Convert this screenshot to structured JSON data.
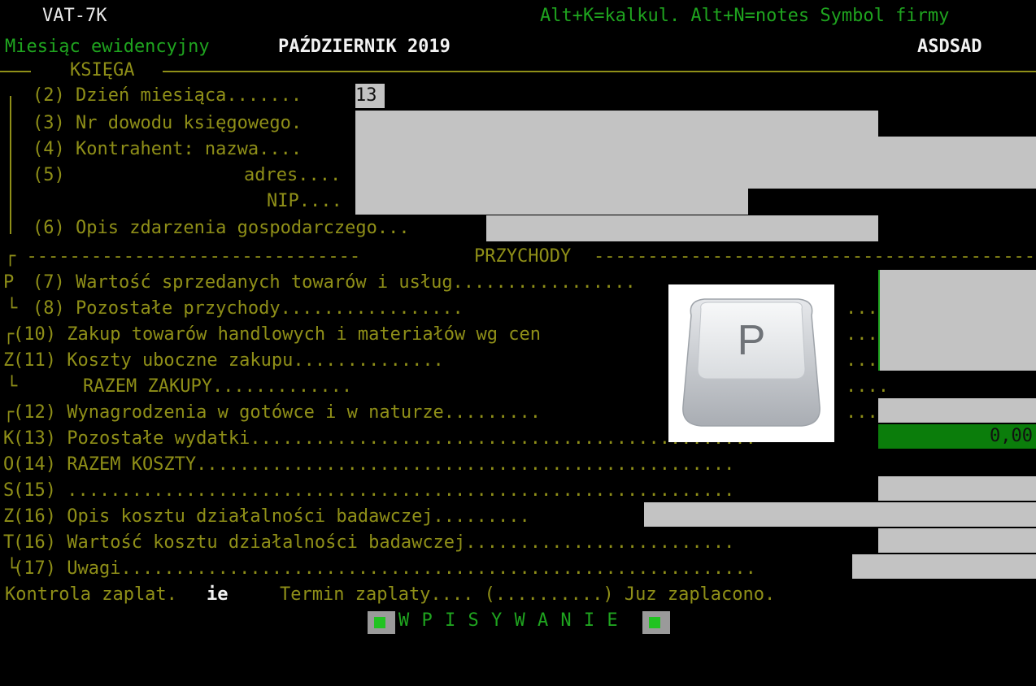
{
  "header": {
    "form_code": "VAT-7K",
    "hotkeys": "Alt+K=kalkul. Alt+N=notes Symbol firmy",
    "month_label": "Miesiąc ewidencyjny",
    "month_value": "PAŹDZIERNIK 2019",
    "company_symbol": "ASDSAD"
  },
  "sections": {
    "ksiega_title": "KSIĘGA",
    "przychody_title": "PRZYCHODY"
  },
  "ksiega": {
    "day_label": "(2) Dzień miesiąca.......",
    "day_value": "13",
    "doc_label": "(3) Nr dowodu księgowego.",
    "contractor_name_label": "(4) Kontrahent: nazwa....",
    "address_num": "(5)",
    "address_label": "adres....",
    "nip_label": "NIP....",
    "description_label": "(6) Opis zdarzenia gospodarczego..."
  },
  "rows": {
    "r7": "(7) Wartość sprzedanych towarów i usług.................",
    "r8": "(8) Pozostałe przychody.................",
    "r10": "(10) Zakup towarów handlowych i materiałów wg cen",
    "r11": "(11) Koszty uboczne zakupu..............",
    "razem_zakupy": "RAZEM ZAKUPY.............",
    "r12": "(12) Wynagrodzenia w gotówce i w naturze.........",
    "r13": "(13) Pozostałe wydatki...............................................",
    "r13_value": "0,00",
    "r14": "(14) RAZEM KOSZTY..................................................",
    "r15": "(15) ..............................................................",
    "r16a": "(16) Opis kosztu działalności badawczej.........",
    "r16b": "(16) Wartość kosztu działalności badawczej.........................",
    "r17": "(17) Uwagi...........................................................",
    "dots_tail": "...."
  },
  "side_letters": {
    "p": "P",
    "z": "Z",
    "k": "K",
    "o": "O",
    "s": "S",
    "z2": "Z",
    "t": "T"
  },
  "footer": {
    "control_label": "Kontrola zaplat.",
    "control_value": "ie",
    "payment_term": "Termin zaplaty.... (..........) Juz zaplacono.",
    "mode": "W P I S Y W A N I E"
  },
  "overlay": {
    "key_letter": "P",
    "icon": "keyboard-key-icon"
  }
}
